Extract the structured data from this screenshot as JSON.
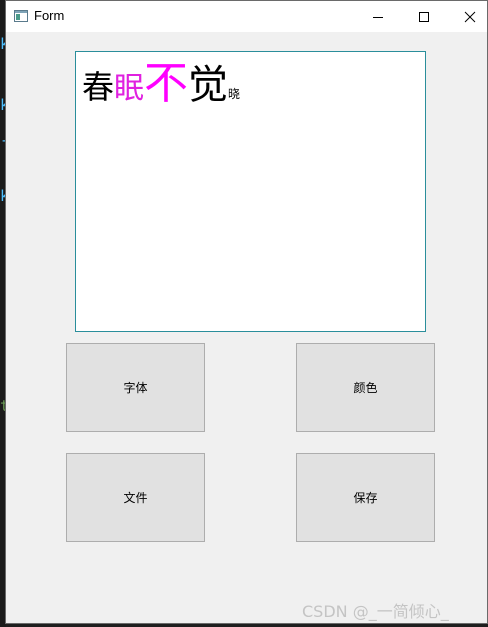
{
  "window": {
    "title": "Form",
    "controls": [
      "minimize",
      "maximize",
      "close"
    ]
  },
  "editor": {
    "chars": [
      {
        "text": "春",
        "color": "#000000"
      },
      {
        "text": "眠",
        "color": "#e020e0"
      },
      {
        "text": "不",
        "color": "#ff00ff"
      },
      {
        "text": "觉",
        "color": "#000000"
      },
      {
        "text": "晓",
        "color": "#000000"
      }
    ]
  },
  "buttons": {
    "font": "字体",
    "color": "颜色",
    "file": "文件",
    "save": "保存"
  },
  "watermark": "CSDN @_一简倾心_",
  "background_strip": {
    "chars": [
      {
        "text": "k",
        "color": "#4fc1ff"
      },
      {
        "text": "k",
        "color": "#4fc1ff"
      },
      {
        "text": "-",
        "color": "#4fc1ff"
      },
      {
        "text": "k",
        "color": "#4fc1ff"
      },
      {
        "text": "t",
        "color": "#6a9955"
      }
    ]
  },
  "colors": {
    "accent_border": "#2a8e9b",
    "button_bg": "#e1e1e1",
    "window_bg": "#f0f0f0"
  }
}
